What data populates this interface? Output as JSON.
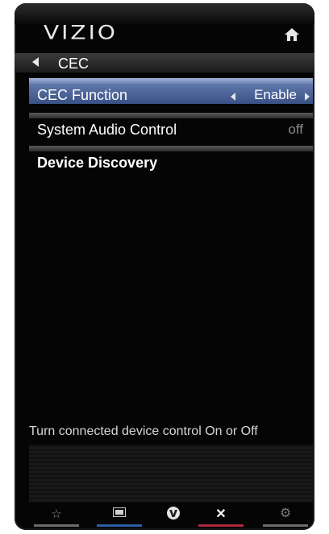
{
  "brand": "VIZIO",
  "menu": {
    "title": "CEC"
  },
  "items": [
    {
      "label": "CEC Function",
      "value": "Enable",
      "selected": true
    },
    {
      "label": "System Audio Control",
      "value": "off",
      "selected": false
    },
    {
      "label": "Device Discovery",
      "value": "",
      "selected": false
    }
  ],
  "help": "Turn connected device control On or Off",
  "footer_buttons": [
    {
      "icon": "star-icon",
      "color": "#6c6c6c"
    },
    {
      "icon": "wide-screen-icon",
      "color": "#2d5fa6"
    },
    {
      "icon": "vizio-v-icon",
      "color": ""
    },
    {
      "icon": "close-icon",
      "color": "#b0283f"
    },
    {
      "icon": "gear-icon",
      "color": "#6c6c6c"
    }
  ],
  "colors": {
    "selected_row": "#4d6499",
    "accent_blue": "#2d5fa6",
    "accent_red": "#b0283f"
  }
}
